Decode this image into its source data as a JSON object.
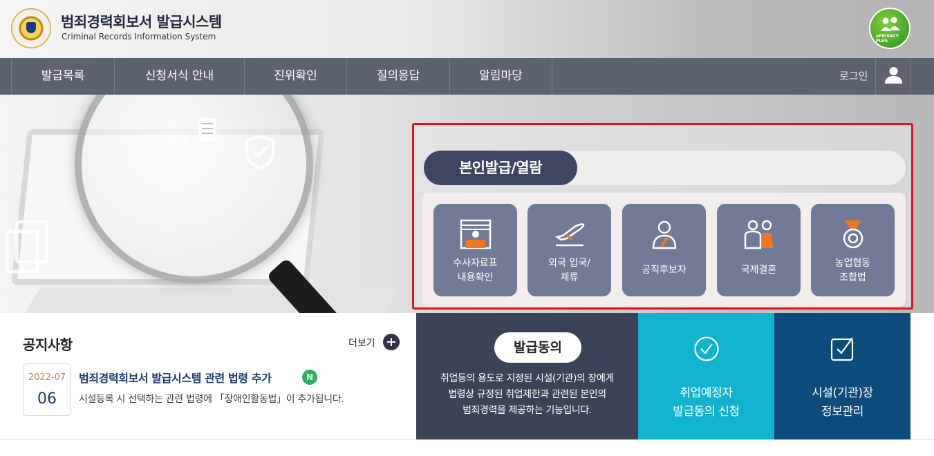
{
  "header": {
    "title": "범죄경력회보서 발급시스템",
    "subtitle": "Criminal Records Information System",
    "badge_label": "ePRIVACY PLUS"
  },
  "nav": {
    "items": [
      "발급목록",
      "신청서식 안내",
      "진위확인",
      "질의응답",
      "알림마당"
    ],
    "login_label": "로그인"
  },
  "issue": {
    "title": "본인발급/열람",
    "cards": [
      {
        "line1": "수사자료표",
        "line2": "내용확인",
        "icon": "id-card-icon"
      },
      {
        "line1": "외국 입국/",
        "line2": "체류",
        "icon": "airplane-icon"
      },
      {
        "line1": "공직후보자",
        "line2": "",
        "icon": "official-person-icon"
      },
      {
        "line1": "국제결혼",
        "line2": "",
        "icon": "couple-icon"
      },
      {
        "line1": "농업협동",
        "line2": "조합법",
        "icon": "medal-icon"
      }
    ]
  },
  "notice": {
    "title": "공지사항",
    "more_label": "더보기",
    "item": {
      "month": "2022-07",
      "day": "06",
      "title": "범죄경력회보서 발급시스템 관련 법령 추가",
      "badge": "N",
      "summary": "시설등록 시 선택하는 관련 법령에 「장애인활동법」이 추가됩니다."
    }
  },
  "consent": {
    "title": "발급동의",
    "desc_lines": [
      "취업등의 용도로 지정된 시설(기관)의 장에게",
      "법령상 규정된 취업제한과 관련된 본인의",
      "범죄경력을 제공하는 기능입니다."
    ]
  },
  "tiles": {
    "apply": {
      "line1": "취업예정자",
      "line2": "발급동의 신청"
    },
    "facility": {
      "line1": "시설(기관)장",
      "line2": "정보관리"
    }
  },
  "colors": {
    "nav_bg": "#5d636d",
    "issue_title_bg": "#3e4563",
    "card_bg": "#737a97",
    "highlight_border": "#e0141e",
    "consent_bg": "#3b4359",
    "apply_bg": "#12b3ce",
    "facility_bg": "#0d4c7a",
    "accent_orange": "#f0781e"
  }
}
